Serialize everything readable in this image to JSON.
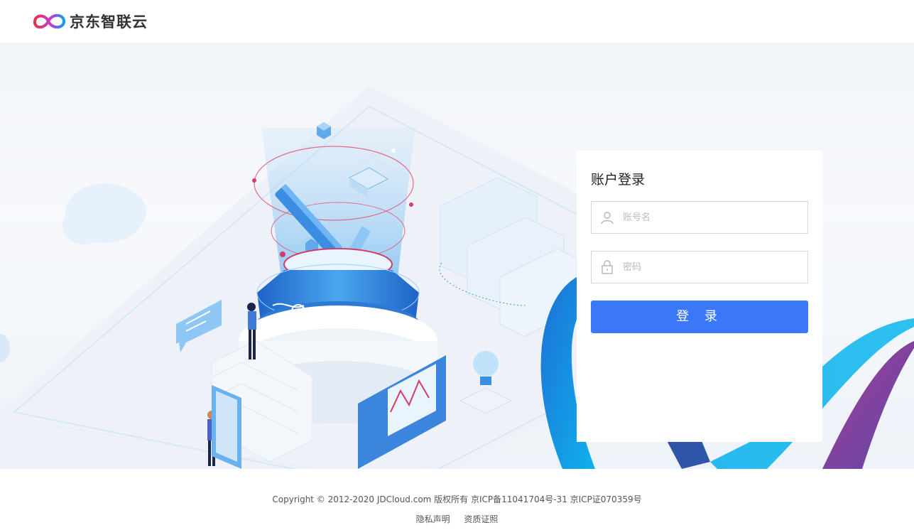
{
  "header": {
    "brand_name": "京东智联云"
  },
  "login": {
    "title": "账户登录",
    "username_placeholder": "账号名",
    "password_placeholder": "密码",
    "submit_label": "登 录"
  },
  "footer": {
    "copyright": "Copyright © 2012-2020 JDCloud.com 版权所有 京ICP备11041704号-31 京ICP证070359号",
    "links": [
      "隐私声明",
      "资质证照"
    ]
  },
  "colors": {
    "primary": "#3a78f7",
    "brand_red": "#e8304a",
    "brand_blue": "#0aa0e8"
  },
  "icons": [
    "user-icon",
    "lock-icon",
    "logo-mark-icon"
  ]
}
